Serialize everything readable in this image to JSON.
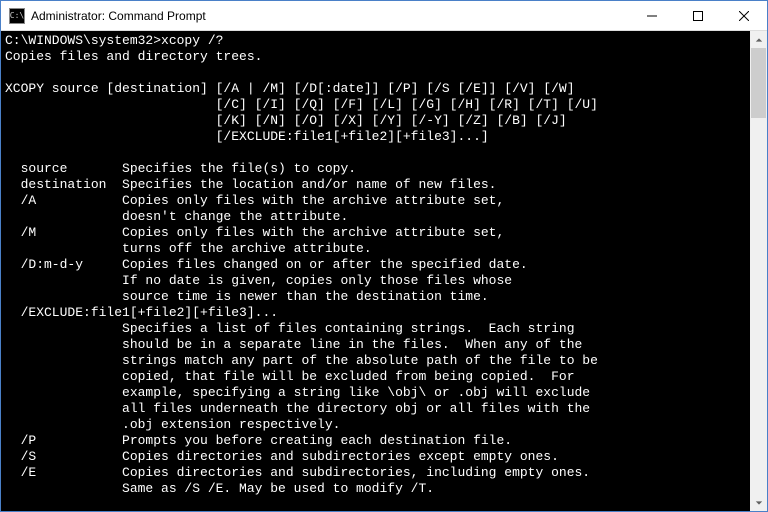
{
  "window": {
    "title": "Administrator: Command Prompt",
    "icon_text": "C:\\"
  },
  "prompt": "C:\\WINDOWS\\system32>",
  "command": "xcopy /?",
  "output": {
    "desc": "Copies files and directory trees.",
    "syntax1": "XCOPY source [destination] [/A | /M] [/D[:date]] [/P] [/S [/E]] [/V] [/W]",
    "syntax2": "                           [/C] [/I] [/Q] [/F] [/L] [/G] [/H] [/R] [/T] [/U]",
    "syntax3": "                           [/K] [/N] [/O] [/X] [/Y] [/-Y] [/Z] [/B] [/J]",
    "syntax4": "                           [/EXCLUDE:file1[+file2][+file3]...]",
    "p_source": "  source       Specifies the file(s) to copy.",
    "p_dest": "  destination  Specifies the location and/or name of new files.",
    "p_a1": "  /A           Copies only files with the archive attribute set,",
    "p_a2": "               doesn't change the attribute.",
    "p_m1": "  /M           Copies only files with the archive attribute set,",
    "p_m2": "               turns off the archive attribute.",
    "p_d1": "  /D:m-d-y     Copies files changed on or after the specified date.",
    "p_d2": "               If no date is given, copies only those files whose",
    "p_d3": "               source time is newer than the destination time.",
    "p_ex0": "  /EXCLUDE:file1[+file2][+file3]...",
    "p_ex1": "               Specifies a list of files containing strings.  Each string",
    "p_ex2": "               should be in a separate line in the files.  When any of the",
    "p_ex3": "               strings match any part of the absolute path of the file to be",
    "p_ex4": "               copied, that file will be excluded from being copied.  For",
    "p_ex5": "               example, specifying a string like \\obj\\ or .obj will exclude",
    "p_ex6": "               all files underneath the directory obj or all files with the",
    "p_ex7": "               .obj extension respectively.",
    "p_p": "  /P           Prompts you before creating each destination file.",
    "p_s": "  /S           Copies directories and subdirectories except empty ones.",
    "p_e1": "  /E           Copies directories and subdirectories, including empty ones.",
    "p_e2": "               Same as /S /E. May be used to modify /T."
  }
}
